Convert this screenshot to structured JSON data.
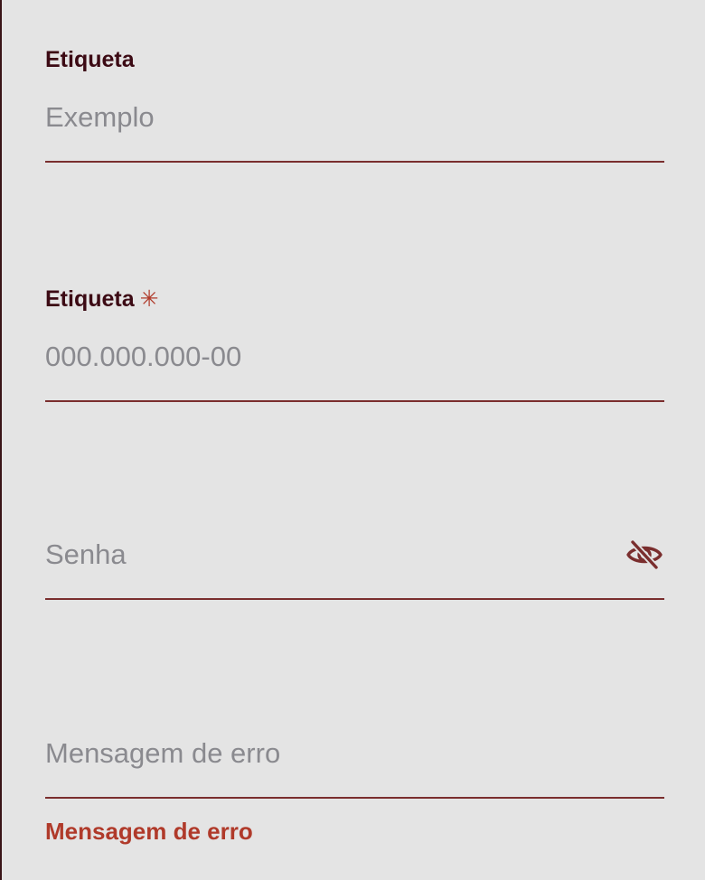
{
  "fields": [
    {
      "label": "Etiqueta",
      "placeholder": "Exemplo",
      "value": ""
    },
    {
      "label": "Etiqueta",
      "required_mark": "✳",
      "placeholder": "000.000.000-00",
      "value": ""
    },
    {
      "placeholder": "Senha",
      "value": "",
      "toggle_icon": "eye-slash-icon"
    },
    {
      "placeholder": "Mensagem de erro",
      "value": "",
      "error_message": "Mensagem de erro"
    }
  ],
  "colors": {
    "background": "#e4e4e4",
    "label": "#3c0a14",
    "placeholder": "#8a8a8f",
    "underline": "#7a2e2e",
    "error": "#b03a2a",
    "required": "#b03a2a",
    "icon": "#7a2e2e"
  }
}
